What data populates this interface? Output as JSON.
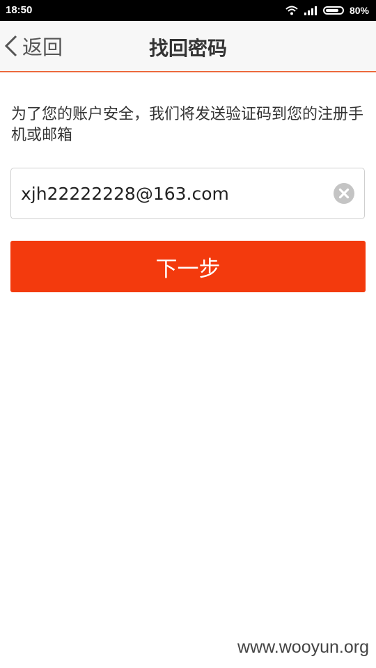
{
  "status_bar": {
    "time": "18:50",
    "battery_percent": "80%",
    "battery_level": 0.8
  },
  "header": {
    "back_label": "返回",
    "title": "找回密码"
  },
  "main": {
    "hint_text": "为了您的账户安全，我们将发送验证码到您的注册手机或邮箱",
    "account_input_value": "xjh22222228@163.com",
    "next_button_label": "下一步"
  },
  "watermark": "www.wooyun.org",
  "colors": {
    "accent": "#f33a0d",
    "header_border": "#ec6a3d"
  },
  "icons": {
    "back": "chevron-left-icon",
    "clear": "clear-circle-icon",
    "wifi": "wifi-icon",
    "signal": "signal-icon",
    "battery": "battery-icon"
  }
}
